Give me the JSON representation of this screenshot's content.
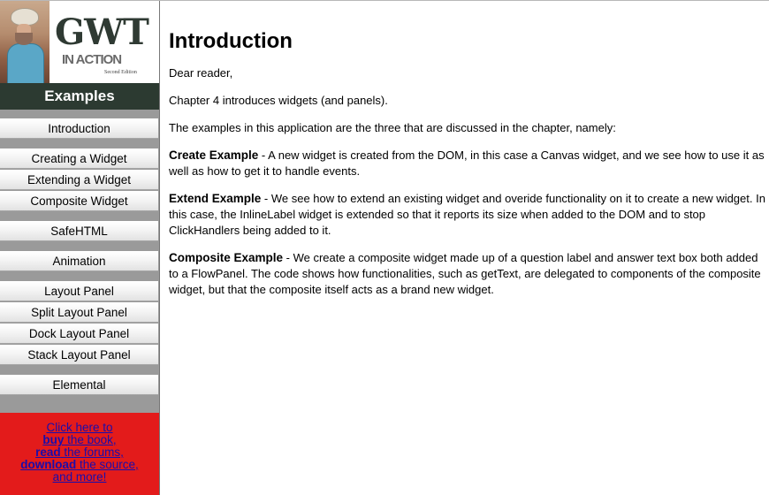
{
  "logo": {
    "title": "GWT",
    "subtitle": "IN ACTION",
    "edition": "Second Edition"
  },
  "sidebar": {
    "header": "Examples",
    "items": [
      {
        "label": "Introduction"
      },
      {
        "label": "Creating a Widget"
      },
      {
        "label": "Extending a Widget"
      },
      {
        "label": "Composite Widget"
      },
      {
        "label": "SafeHTML"
      },
      {
        "label": "Animation"
      },
      {
        "label": "Layout Panel"
      },
      {
        "label": "Split Layout Panel"
      },
      {
        "label": "Dock Layout Panel"
      },
      {
        "label": "Stack Layout Panel"
      },
      {
        "label": "Elemental"
      }
    ]
  },
  "promo": {
    "line1": "Click here to",
    "buy": "buy",
    "buy_rest": " the book,",
    "read": "read",
    "read_rest": " the forums,",
    "download": "download",
    "download_rest": " the source,",
    "more": "and more!"
  },
  "main": {
    "title": "Introduction",
    "greeting": "Dear reader,",
    "intro": "Chapter 4 introduces widgets (and panels).",
    "examples_intro": "The examples in this application are the three that are discussed in the chapter, namely:",
    "create_title": "Create Example",
    "create_text": " - A new widget is created from the DOM, in this case a Canvas widget, and we see how to use it as well as how to get it to handle events.",
    "extend_title": "Extend Example",
    "extend_text": " - We see how to extend an existing widget and overide functionality on it to create a new widget. In this case, the InlineLabel widget is extended so that it reports its size when added to the DOM and to stop ClickHandlers being added to it.",
    "composite_title": "Composite Example",
    "composite_text": " - We create a composite widget made up of a question label and answer text box both added to a FlowPanel. The code shows how functionalities, such as getText, are delegated to components of the composite widget, but that the composite itself acts as a brand new widget."
  }
}
